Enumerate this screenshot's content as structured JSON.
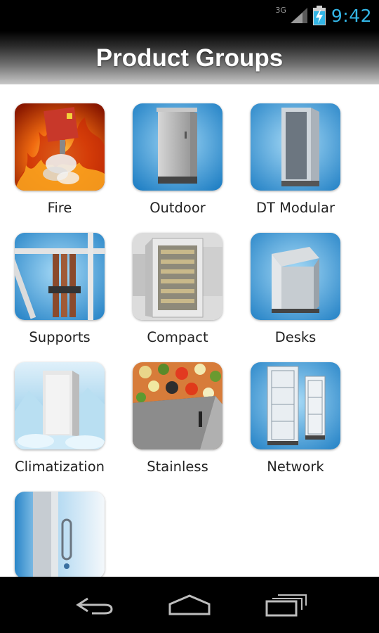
{
  "status_bar": {
    "network_type": "3G",
    "time": "9:42",
    "accent_color": "#33b5e5"
  },
  "header": {
    "title": "Product Groups"
  },
  "products": [
    {
      "label": "Fire",
      "icon": "fire-product-image"
    },
    {
      "label": "Outdoor",
      "icon": "outdoor-product-image"
    },
    {
      "label": "DT Modular",
      "icon": "dt-modular-product-image"
    },
    {
      "label": "Supports",
      "icon": "supports-product-image"
    },
    {
      "label": "Compact",
      "icon": "compact-product-image"
    },
    {
      "label": "Desks",
      "icon": "desks-product-image"
    },
    {
      "label": "Climatization",
      "icon": "climatization-product-image"
    },
    {
      "label": "Stainless",
      "icon": "stainless-product-image"
    },
    {
      "label": "Network",
      "icon": "network-product-image"
    },
    {
      "label": "",
      "icon": "accessory-product-image"
    }
  ],
  "nav_bar": {
    "icons": [
      "back-icon",
      "home-icon",
      "recent-apps-icon"
    ]
  }
}
